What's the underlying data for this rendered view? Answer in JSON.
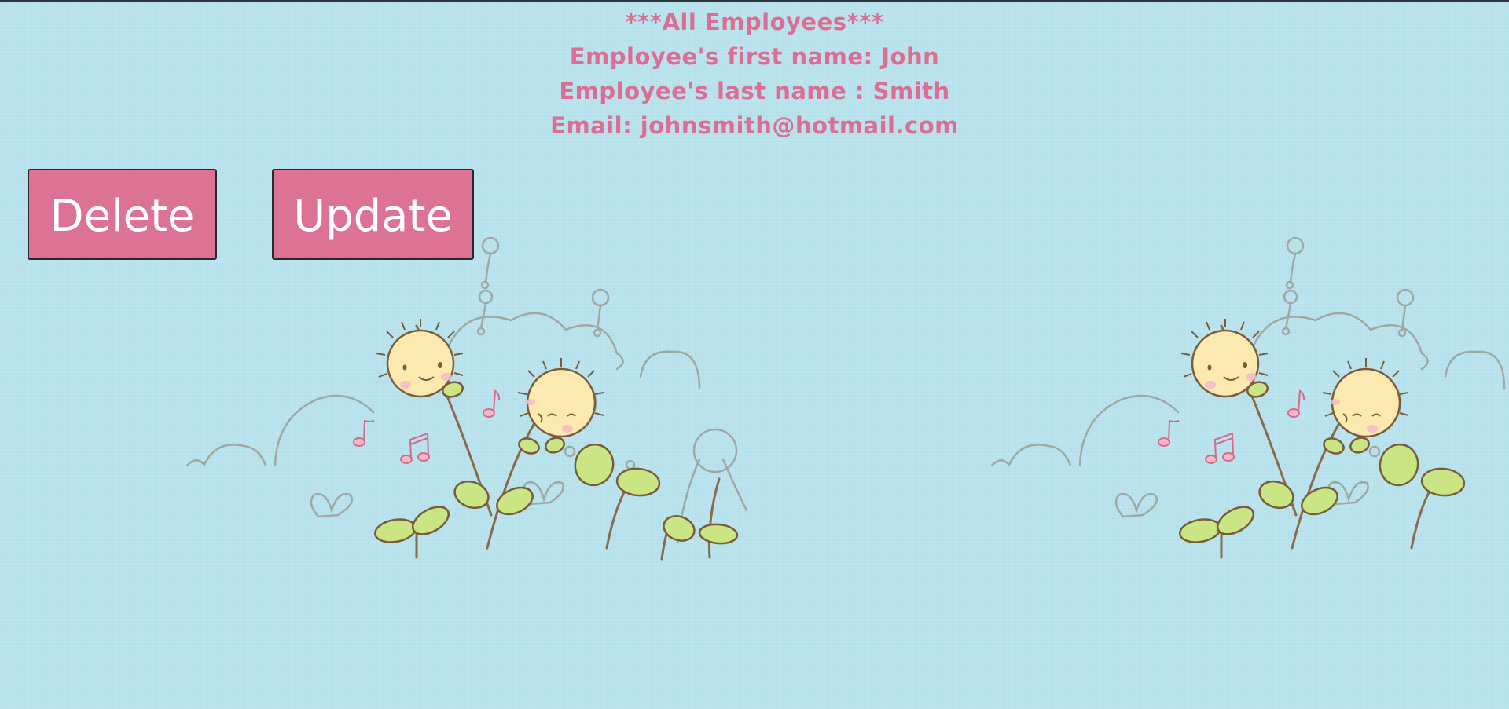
{
  "employee": {
    "heading": "***All Employees***",
    "first_name_line": "Employee's first name: John",
    "last_name_line": "Employee's last name : Smith",
    "email_line": "Email: johnsmith@hotmail.com"
  },
  "actions": {
    "delete_label": "Delete",
    "update_label": "Update"
  },
  "colors": {
    "background": "#b9e3ec",
    "text_accent": "#dc6e93",
    "button_fill": "#dc7395",
    "button_text": "#ffffff"
  },
  "decoration": {
    "icon": "flower-music-illustration",
    "repeat_count": 2
  }
}
